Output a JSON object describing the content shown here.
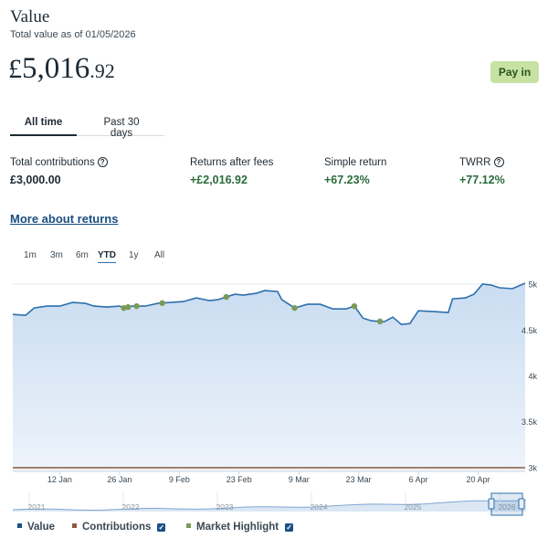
{
  "header": {
    "title": "Value",
    "subtitle": "Total value as of 01/05/2026",
    "currency": "£",
    "value_main": "5,016",
    "value_decimal": ".92",
    "pay_in_label": "Pay in"
  },
  "tabs": [
    "All time",
    "Past 30 days"
  ],
  "stats": [
    {
      "label": "Total contributions",
      "value": "£3,000.00",
      "positive": false,
      "help": true
    },
    {
      "label": "Returns after fees",
      "value": "+£2,016.92",
      "positive": true,
      "help": false
    },
    {
      "label": "Simple return",
      "value": "+67.23%",
      "positive": true,
      "help": false
    },
    {
      "label": "TWRR",
      "value": "+77.12%",
      "positive": true,
      "help": true
    }
  ],
  "more_link": "More about returns",
  "ranges": [
    "1m",
    "3m",
    "6m",
    "YTD",
    "1y",
    "All"
  ],
  "active_range": "YTD",
  "chart_data": {
    "type": "area",
    "y_ticks": [
      "5k",
      "4.5k",
      "4k",
      "3.5k",
      "3k"
    ],
    "ylim": [
      2960,
      5050
    ],
    "x_ticks": [
      "12 Jan",
      "26 Jan",
      "9 Feb",
      "23 Feb",
      "9 Mar",
      "23 Mar",
      "6 Apr",
      "20 Apr"
    ],
    "xlim": [
      "2026-01-01",
      "2026-05-01"
    ],
    "value_series": {
      "name": "Value",
      "color": "#2c6fad",
      "points": [
        [
          "2026-01-01",
          4670
        ],
        [
          "2026-01-04",
          4660
        ],
        [
          "2026-01-06",
          4740
        ],
        [
          "2026-01-09",
          4760
        ],
        [
          "2026-01-12",
          4760
        ],
        [
          "2026-01-15",
          4800
        ],
        [
          "2026-01-18",
          4790
        ],
        [
          "2026-01-20",
          4760
        ],
        [
          "2026-01-23",
          4750
        ],
        [
          "2026-01-26",
          4760
        ],
        [
          "2026-01-27",
          4740
        ],
        [
          "2026-01-29",
          4760
        ],
        [
          "2026-02-01",
          4760
        ],
        [
          "2026-02-04",
          4790
        ],
        [
          "2026-02-07",
          4800
        ],
        [
          "2026-02-10",
          4810
        ],
        [
          "2026-02-13",
          4850
        ],
        [
          "2026-02-16",
          4820
        ],
        [
          "2026-02-18",
          4830
        ],
        [
          "2026-02-20",
          4860
        ],
        [
          "2026-02-22",
          4890
        ],
        [
          "2026-02-24",
          4880
        ],
        [
          "2026-02-27",
          4900
        ],
        [
          "2026-03-01",
          4930
        ],
        [
          "2026-03-04",
          4920
        ],
        [
          "2026-03-05",
          4830
        ],
        [
          "2026-03-08",
          4740
        ],
        [
          "2026-03-11",
          4780
        ],
        [
          "2026-03-14",
          4780
        ],
        [
          "2026-03-17",
          4730
        ],
        [
          "2026-03-20",
          4730
        ],
        [
          "2026-03-22",
          4760
        ],
        [
          "2026-03-24",
          4630
        ],
        [
          "2026-03-26",
          4600
        ],
        [
          "2026-03-29",
          4590
        ],
        [
          "2026-03-31",
          4640
        ],
        [
          "2026-04-02",
          4560
        ],
        [
          "2026-04-04",
          4570
        ],
        [
          "2026-04-06",
          4710
        ],
        [
          "2026-04-10",
          4700
        ],
        [
          "2026-04-13",
          4690
        ],
        [
          "2026-04-14",
          4840
        ],
        [
          "2026-04-17",
          4850
        ],
        [
          "2026-04-19",
          4890
        ],
        [
          "2026-04-21",
          5000
        ],
        [
          "2026-04-23",
          4990
        ],
        [
          "2026-04-25",
          4960
        ],
        [
          "2026-04-28",
          4950
        ],
        [
          "2026-05-01",
          5010
        ]
      ]
    },
    "contributions_series": {
      "name": "Contributions",
      "color": "#8a5a3c",
      "value": 3000
    },
    "highlights": {
      "name": "Market Highlight",
      "color": "#7a9a55",
      "dates": [
        "2026-01-27",
        "2026-01-28",
        "2026-01-30",
        "2026-02-05",
        "2026-02-20",
        "2026-03-08",
        "2026-03-22",
        "2026-03-28"
      ]
    },
    "navigator": {
      "years": [
        "2021",
        "2022",
        "2023",
        "2024",
        "2025",
        "2026"
      ]
    }
  },
  "legend": [
    {
      "label": "Value",
      "color": "#1c4f86",
      "checkbox": false
    },
    {
      "label": "Contributions",
      "color": "#8a5a3c",
      "checkbox": true
    },
    {
      "label": "Market Highlight",
      "color": "#7a9a55",
      "checkbox": true
    }
  ]
}
